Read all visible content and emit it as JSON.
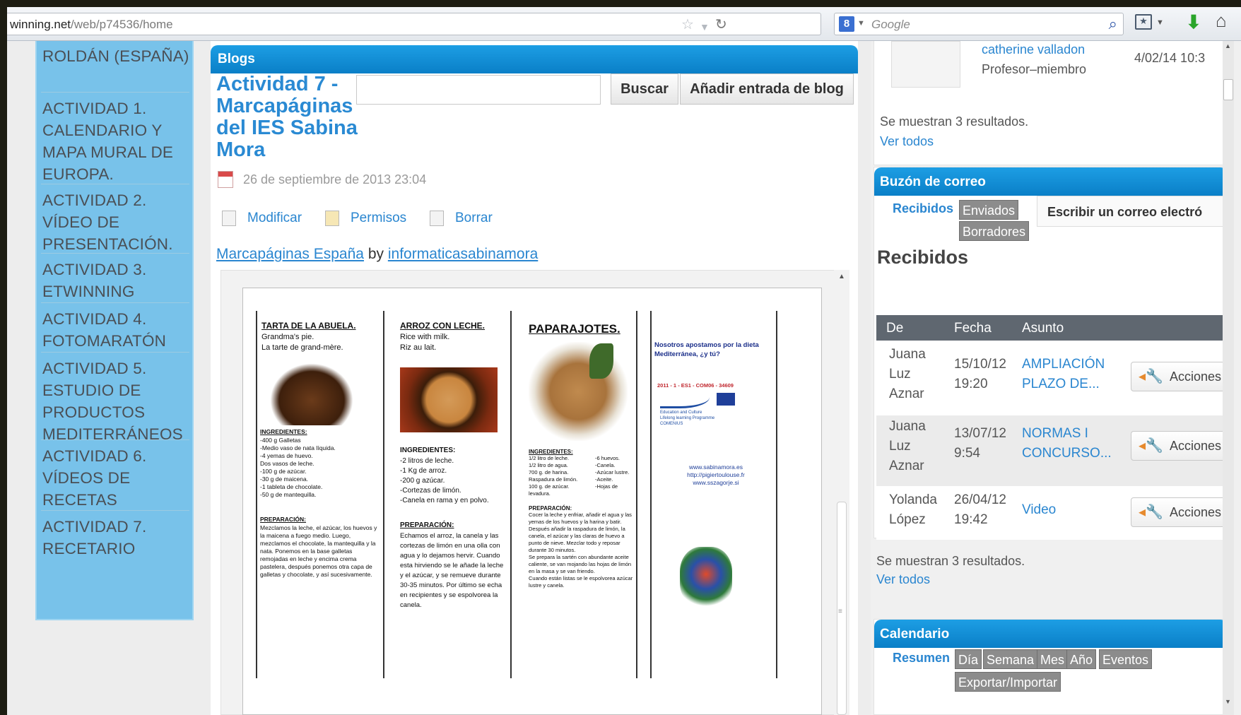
{
  "browser": {
    "url_domain": "winning.net",
    "url_path": "/web/p74536/home",
    "search_placeholder": "Google",
    "search_engine_badge": "8",
    "icons": [
      "star-icon",
      "dropdown-icon",
      "reload-icon",
      "search-icon",
      "bookmark-icon",
      "download-icon",
      "home-icon"
    ]
  },
  "left_nav": {
    "items": [
      {
        "label": "ROLDÁN (ESPAÑA)"
      },
      {
        "label": "ACTIVIDAD 1. CALENDARIO Y MAPA MURAL DE EUROPA."
      },
      {
        "label": "ACTIVIDAD 2. VÍDEO DE PRESENTACIÓN."
      },
      {
        "label": "ACTIVIDAD 3. ETWINNING"
      },
      {
        "label": "ACTIVIDAD 4. FOTOMARATÓN"
      },
      {
        "label": "ACTIVIDAD 5. ESTUDIO DE PRODUCTOS MEDITERRÁNEOS"
      },
      {
        "label": "ACTIVIDAD 6. VÍDEOS DE RECETAS"
      },
      {
        "label": "ACTIVIDAD 7. RECETARIO"
      }
    ]
  },
  "blogs": {
    "header": "Blogs",
    "title": "Actividad 7 - Marcapáginas del IES Sabina Mora",
    "search_button": "Buscar",
    "add_button": "Añadir entrada de blog",
    "date": "26 de septiembre de 2013 23:04",
    "actions": [
      "Modificar",
      "Permisos",
      "Borrar"
    ],
    "credit_doc": "Marcapáginas España",
    "credit_by": "by",
    "credit_author": "informaticasabinamora"
  },
  "document": {
    "col1": {
      "title": "TARTA DE LA ABUELA.",
      "subtitle": "Grandma's pie.\nLa tarte de grand-mère.",
      "ing_title": "INGREDIENTES:",
      "ingredients": "-400 g Galletas\n-Medio vaso de nata líquida.\n-4 yemas de huevo.\nDos vasos de leche.\n-100 g de azúcar.\n-30 g de maicena.\n-1 tableta de chocolate.\n-50 g de mantequilla.",
      "prep_title": "PREPARACIÓN:",
      "prep": "Mezclamos la leche, el azúcar, los huevos y la maicena a fuego medio. Luego, mezclamos el chocolate, la mantequilla y la nata. Ponemos en la base galletas remojadas en leche y encima crema pastelera, después ponemos otra capa de galletas y chocolate, y así sucesivamente."
    },
    "col2": {
      "title": "ARROZ CON LECHE.",
      "subtitle": "Rice with milk.\nRiz au lait.",
      "ing_title": "INGREDIENTES:",
      "ingredients": "-2 litros de leche.\n-1 Kg de arroz.\n-200 g azúcar.\n-Cortezas de limón.\n-Canela en rama y en polvo.",
      "prep_title": "PREPARACIÓN:",
      "prep": "Echamos el arroz, la canela y las cortezas de limón en una olla con agua y lo dejamos hervir. Cuando esta hirviendo se le añade la leche y el azúcar, y se remueve durante 30-35 minutos. Por último se echa en recipientes y se espolvorea la canela."
    },
    "col3": {
      "title": "PAPARAJOTES.",
      "ing_title": "INGREDIENTES:",
      "ingredients": "1/2 litro de leche.\n1/2 litro de agua.\n700 g. de harina.\nRaspadura de limón.\n100 g. de azúcar.\nlevadura.",
      "ingredients2": "-6 huevos.\n-Canela.\n-Azúcar lustre.\n-Aceite.\n-Hojas de",
      "prep_title": "PREPARACIÓN:",
      "prep": "Cocer la leche y enfriar, añadir el agua y las yemas de los huevos y la harina y batir.\nDespués añadir la raspadura de limón, la canela, el azúcar y las claras de huevo a punto de nieve. Mezclar todo y reposar durante 30 minutos.\nSe prepara la sartén con abundante aceite caliente, se van mojando las hojas de limón en la masa y se van friendo.\nCuando están listas se le espolvorea azúcar lustre y canela."
    },
    "col4": {
      "slogan": "Nosotros apostamos por la dieta Mediterránea, ¿y tú?",
      "project_code": "2011 - 1 - ES1 - COM06 - 34609",
      "program_text": "Education and Culture\nLifelong learning Programme\nCOMENIUS",
      "links": "www.sabinamora.es\nhttp://pigiertoulouse.fr\nwww.sszagorje.si"
    }
  },
  "profile": {
    "name": "catherine valladon",
    "role": "Profesor–miembro",
    "date": "4/02/14 10:3",
    "results": "Se muestran 3 resultados.",
    "see_all": "Ver todos"
  },
  "mailbox": {
    "header": "Buzón de correo",
    "tabs": [
      "Recibidos",
      "Enviados",
      "Borradores"
    ],
    "compose": "Escribir un correo electró",
    "section_title": "Recibidos",
    "columns": [
      "De",
      "Fecha",
      "Asunto"
    ],
    "rows": [
      {
        "from": "Juana Luz Aznar",
        "date": "15/10/12",
        "time": "19:20",
        "subject": "AMPLIACIÓN PLAZO DE...",
        "action": "Acciones"
      },
      {
        "from": "Juana Luz Aznar",
        "date": "13/07/12",
        "time": "9:54",
        "subject": "NORMAS I CONCURSO...",
        "action": "Acciones"
      },
      {
        "from": "Yolanda López",
        "date": "26/04/12",
        "time": "19:42",
        "subject": "Video",
        "action": "Acciones"
      }
    ],
    "results": "Se muestran 3 resultados.",
    "see_all": "Ver todos"
  },
  "calendar": {
    "header": "Calendario",
    "tabs": [
      "Resumen",
      "Día",
      "Semana",
      "Mes",
      "Año",
      "Eventos"
    ],
    "export": "Exportar/Importar"
  }
}
